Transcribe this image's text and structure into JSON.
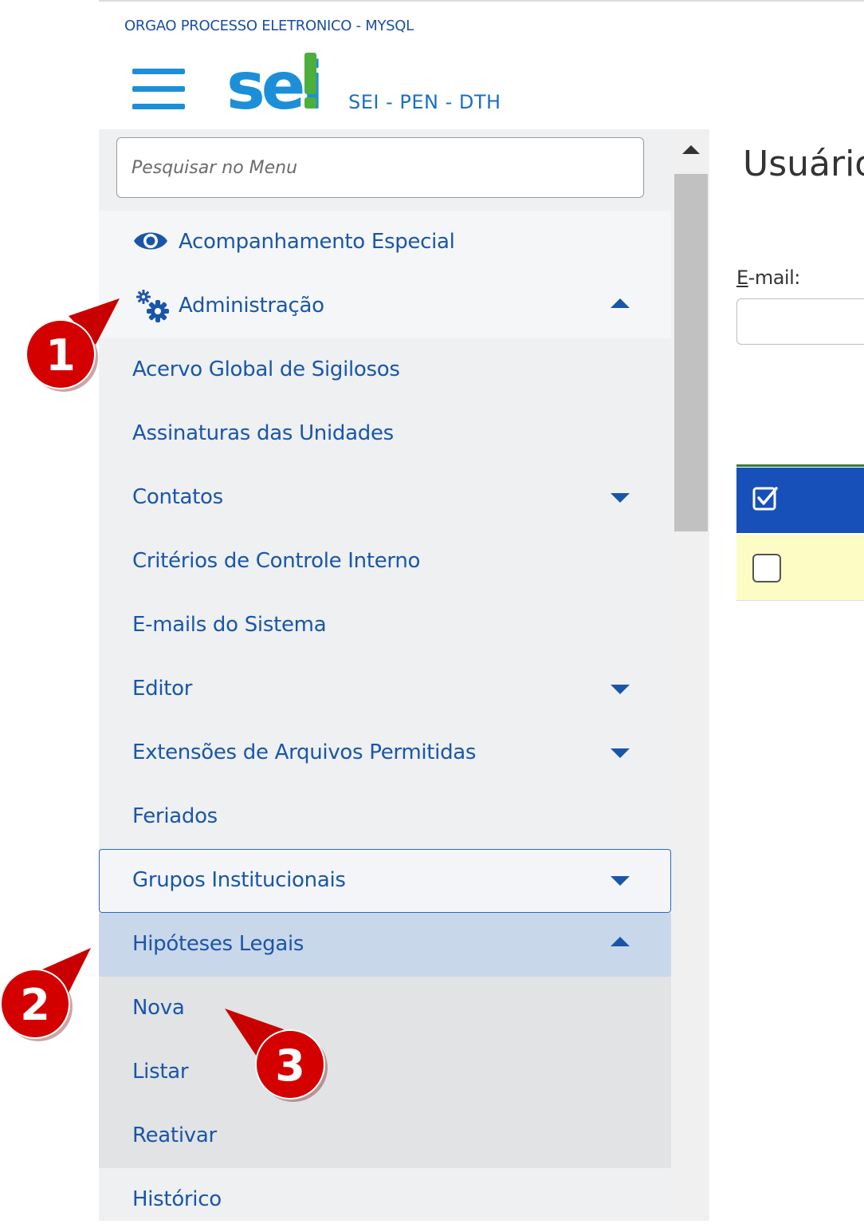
{
  "header": {
    "org_name": "ORGAO PROCESSO ELETRONICO - MYSQL",
    "logo_text": "sei!",
    "system_name": "SEI - PEN - DTH"
  },
  "sidebar": {
    "search_placeholder": "Pesquisar no Menu",
    "top_items": [
      {
        "label": "Acompanhamento Especial",
        "icon": "eye-icon"
      },
      {
        "label": "Administração",
        "icon": "gears-icon"
      }
    ],
    "admin_items": [
      "Acervo Global de Sigilosos",
      "Assinaturas das Unidades",
      "Contatos",
      "Critérios de Controle Interno",
      "E-mails do Sistema",
      "Editor",
      "Extensões de Arquivos Permitidas",
      "Feriados",
      "Grupos Institucionais",
      "Hipóteses Legais"
    ],
    "hipoteses_submenu": [
      "Nova",
      "Listar",
      "Reativar"
    ],
    "after_items": [
      "Histórico"
    ]
  },
  "main": {
    "page_title": "Usuário",
    "email_label_first": "E",
    "email_label_rest": "-mail:"
  },
  "callouts": [
    "1",
    "2",
    "3"
  ],
  "colors": {
    "link_blue": "#1a56a8",
    "brand_blue": "#1c8fd8",
    "table_header": "#1750b8",
    "row_highlight": "#fdfcc4",
    "callout_red": "#d40000"
  }
}
